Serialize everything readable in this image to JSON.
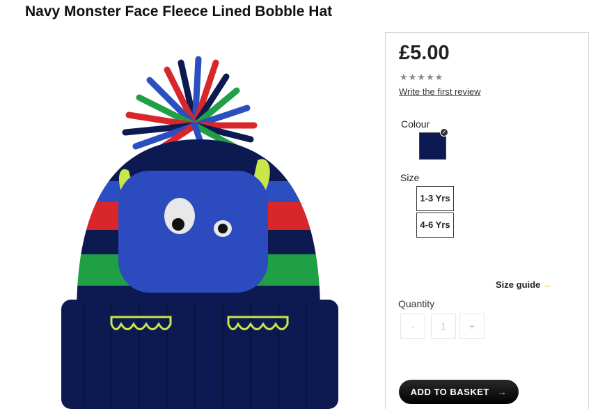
{
  "product": {
    "title": "Navy Monster Face Fleece Lined Bobble Hat",
    "image_alt": "Navy monster face bobble hat",
    "price": "£5.00",
    "rating_stars": "★★★★★",
    "rating_value": 0,
    "review_link": "Write the first review"
  },
  "colour": {
    "label": "Colour",
    "selected_swatch": "#0d1a52",
    "check_icon": "✓"
  },
  "size": {
    "label": "Size",
    "options": [
      "1-3 Yrs",
      "4-6 Yrs"
    ],
    "guide_label": "Size guide",
    "guide_arrow": "→"
  },
  "quantity": {
    "label": "Quantity",
    "minus": "-",
    "value": "1",
    "plus": "+"
  },
  "basket": {
    "label": "ADD TO BASKET",
    "arrow": "→"
  },
  "colors": {
    "accent_arrow": "#f0a500",
    "hat_navy": "#0d1a52",
    "stripe_red": "#d9262a",
    "stripe_blue": "#2b4fc0",
    "stripe_green": "#20a045",
    "monster_blue": "#2c4bbf",
    "horn_lime": "#c9e64a"
  }
}
